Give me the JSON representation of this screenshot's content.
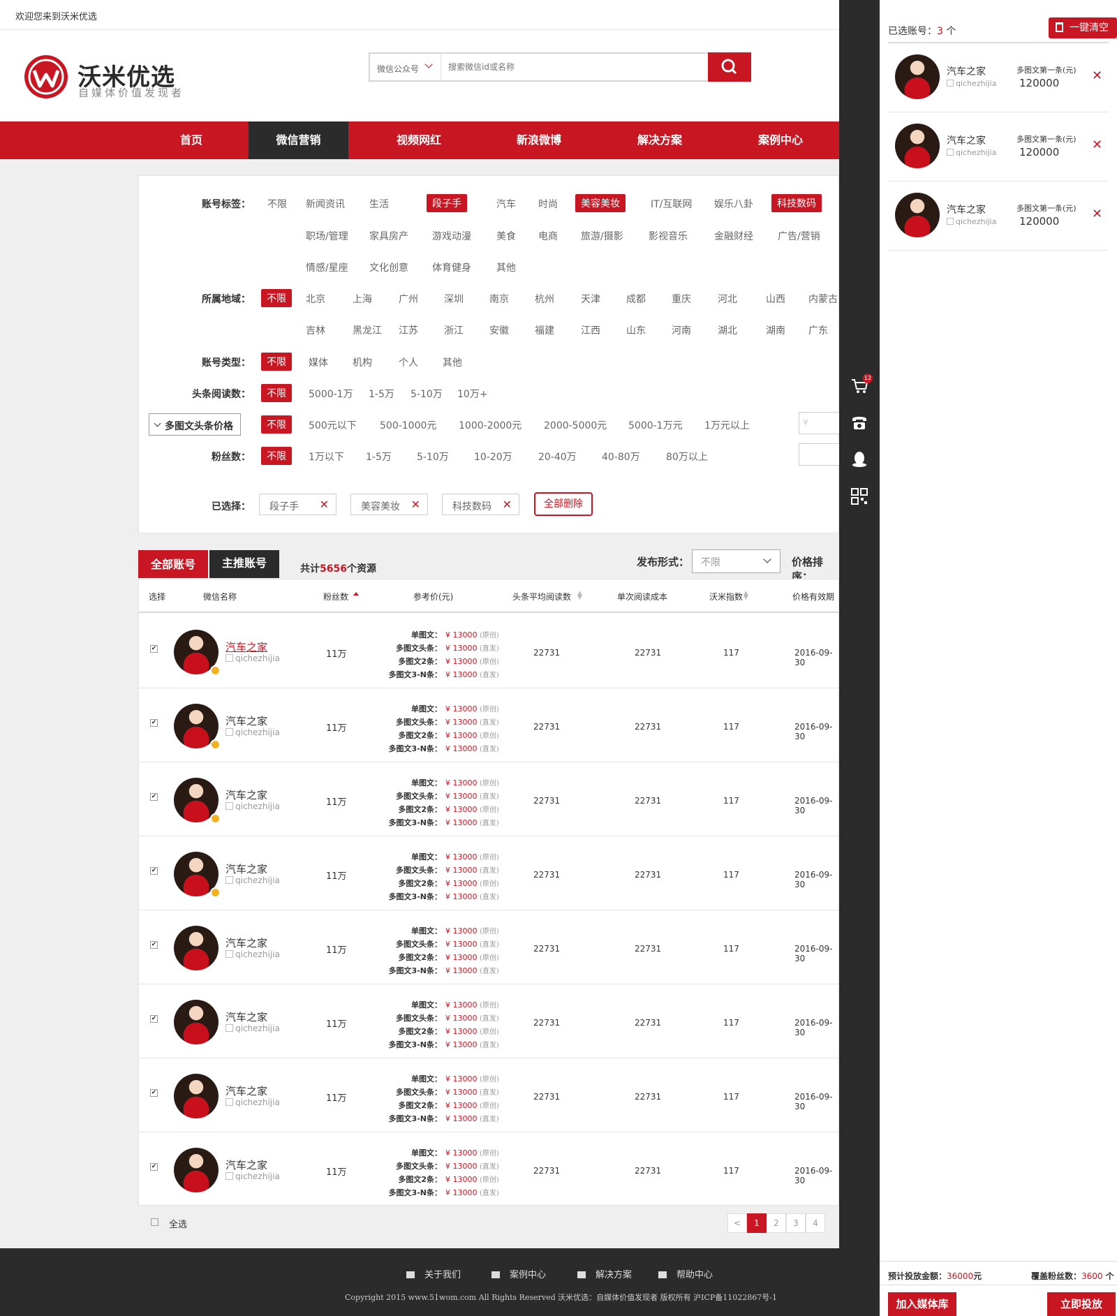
{
  "topbar": {
    "welcome": "欢迎您来到沃米优选"
  },
  "header": {
    "brand": "沃米优选",
    "slogan": "自媒体价值发现者",
    "search_select": "微信公众号",
    "search_placeholder": "搜索微信id或名称",
    "search_icon": "search-icon"
  },
  "nav": {
    "items": [
      "首页",
      "微信营销",
      "视频网红",
      "新浪微博",
      "解决方案",
      "案例中心"
    ],
    "active": "微信营销"
  },
  "filters": {
    "tags_label": "账号标签：",
    "tags": [
      "不限",
      "新闻资讯",
      "生活",
      "段子手",
      "汽车",
      "时尚",
      "美容美妆",
      "IT/互联网",
      "娱乐八卦",
      "科技数码",
      "职场/管理",
      "家具房产",
      "游戏动漫",
      "美食",
      "电商",
      "旅游/摄影",
      "影视音乐",
      "金融财经",
      "广告/营销",
      "情感/星座",
      "文化创意",
      "体育健身",
      "其他"
    ],
    "tags_selected": [
      "段子手",
      "美容美妆",
      "科技数码"
    ],
    "region_label": "所属地域：",
    "regions": [
      "不限",
      "北京",
      "上海",
      "广州",
      "深圳",
      "南京",
      "杭州",
      "天津",
      "成都",
      "重庆",
      "河北",
      "山西",
      "内蒙古",
      "吉林",
      "黑龙江",
      "江苏",
      "浙江",
      "安徽",
      "福建",
      "江西",
      "山东",
      "河南",
      "湖北",
      "湖南",
      "广东"
    ],
    "type_label": "账号类型：",
    "types": [
      "不限",
      "媒体",
      "机构",
      "个人",
      "其他"
    ],
    "reads_label": "头条阅读数：",
    "reads": [
      "不限",
      "5000-1万",
      "1-5万",
      "5-10万",
      "10万+"
    ],
    "price_label": "多图文头条价格",
    "prices": [
      "不限",
      "500元以下",
      "500-1000元",
      "1000-2000元",
      "2000-5000元",
      "5000-1万元",
      "1万元以上"
    ],
    "price_input_placeholder": "¥",
    "fans_label": "粉丝数：",
    "fans": [
      "不限",
      "1万以下",
      "1-5万",
      "5-10万",
      "10-20万",
      "20-40万",
      "40-80万",
      "80万以上"
    ],
    "selected_label": "已选择：",
    "selected": [
      "段子手",
      "美容美妆",
      "科技数码"
    ],
    "clear_all": "全部删除"
  },
  "list": {
    "tab_all": "全部账号",
    "tab_main": "主推账号",
    "total_prefix": "共计",
    "total": "5656",
    "total_suffix": "个资源",
    "pub_label": "发布形式：",
    "pub_value": "不限",
    "price_sort": "价格排序：",
    "headers": [
      "选择",
      "微信名称",
      "粉丝数",
      "参考价(元)",
      "头条平均阅读数",
      "单次阅读成本",
      "沃米指数",
      "价格有效期"
    ],
    "rows": [
      {
        "name": "汽车之家",
        "id": "qichezhijia",
        "fans": "11万",
        "avg": "22731",
        "cost": "22731",
        "index": "117",
        "date": "2016-09-30"
      },
      {
        "name": "汽车之家",
        "id": "qichezhijia",
        "fans": "11万",
        "avg": "22731",
        "cost": "22731",
        "index": "117",
        "date": "2016-09-30"
      },
      {
        "name": "汽车之家",
        "id": "qichezhijia",
        "fans": "11万",
        "avg": "22731",
        "cost": "22731",
        "index": "117",
        "date": "2016-09-30"
      },
      {
        "name": "汽车之家",
        "id": "qichezhijia",
        "fans": "11万",
        "avg": "22731",
        "cost": "22731",
        "index": "117",
        "date": "2016-09-30"
      },
      {
        "name": "汽车之家",
        "id": "qichezhijia",
        "fans": "11万",
        "avg": "22731",
        "cost": "22731",
        "index": "117",
        "date": "2016-09-30"
      },
      {
        "name": "汽车之家",
        "id": "qichezhijia",
        "fans": "11万",
        "avg": "22731",
        "cost": "22731",
        "index": "117",
        "date": "2016-09-30"
      },
      {
        "name": "汽车之家",
        "id": "qichezhijia",
        "fans": "11万",
        "avg": "22731",
        "cost": "22731",
        "index": "117",
        "date": "2016-09-30"
      },
      {
        "name": "汽车之家",
        "id": "qichezhijia",
        "fans": "11万",
        "avg": "22731",
        "cost": "22731",
        "index": "117",
        "date": "2016-09-30"
      }
    ],
    "price_lines": [
      {
        "k": "单图文：",
        "v": "¥ 13000",
        "t": "(原创)"
      },
      {
        "k": "多图文头条：",
        "v": "¥ 13000",
        "t": "(直发)"
      },
      {
        "k": "多图文2条：",
        "v": "¥ 13000",
        "t": "(原创)"
      },
      {
        "k": "多图文3-N条：",
        "v": "¥ 13000",
        "t": "(直发)"
      }
    ],
    "select_all": "全选",
    "pages": [
      "1",
      "2",
      "3",
      "4"
    ]
  },
  "footer": {
    "links": [
      "关于我们",
      "案例中心",
      "解决方案",
      "帮助中心"
    ],
    "copyright": "Copyright 2015 www.51wom.com All Rights Reserved 沃米优选：自媒体价值发现者 版权所有 沪ICP备11022867号-1"
  },
  "sidebar": {
    "cart_count": "12",
    "icons": [
      "cart-icon",
      "phone-icon",
      "qq-icon",
      "qrcode-icon"
    ]
  },
  "panel": {
    "selected_prefix": "已选账号：",
    "selected_count": "3",
    "selected_suffix": " 个",
    "clear_label": "一键清空",
    "items": [
      {
        "name": "汽车之家",
        "id": "qichezhijia",
        "type": "多图文第一条(元)",
        "price": "120000"
      },
      {
        "name": "汽车之家",
        "id": "qichezhijia",
        "type": "多图文第一条(元)",
        "price": "120000"
      },
      {
        "name": "汽车之家",
        "id": "qichezhijia",
        "type": "多图文第一条(元)",
        "price": "120000"
      }
    ],
    "budget_label": "预计投放金额：",
    "budget": "36000",
    "budget_unit": "元",
    "cover_label": "覆盖粉丝数：",
    "cover": "3600",
    "cover_unit": " 个",
    "btn_add": "加入媒体库",
    "btn_go": "立即投放"
  },
  "colors": {
    "brand": "#c81623",
    "dark": "#2b2b2b"
  }
}
